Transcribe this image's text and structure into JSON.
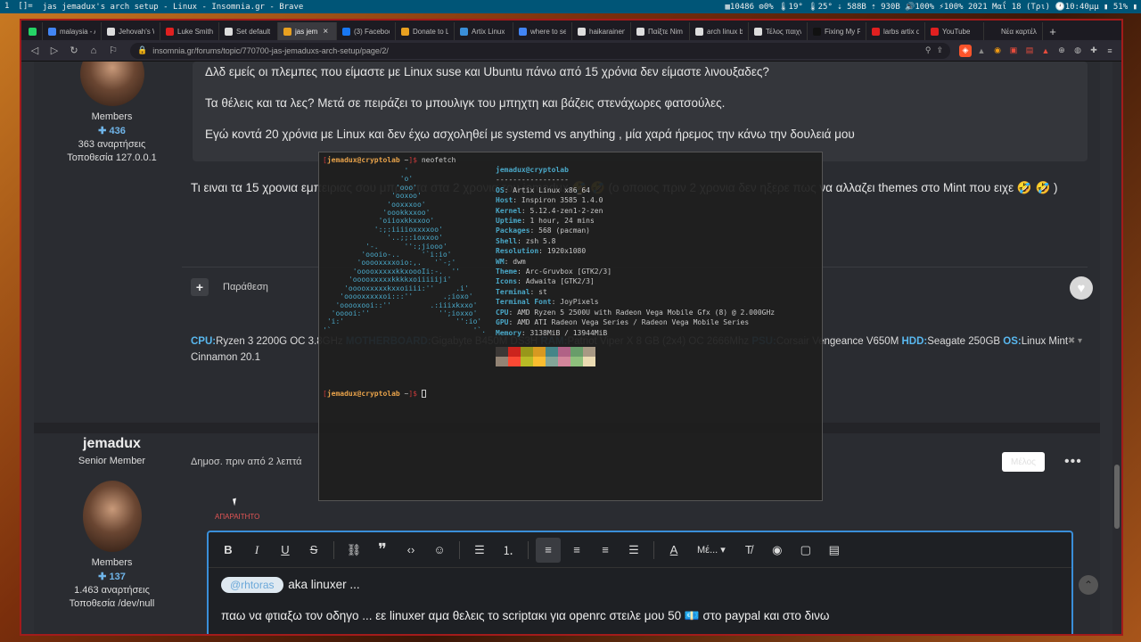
{
  "statusbar": {
    "tags": "1",
    "layout": "[]=",
    "title": "jas jemadux's arch setup - Linux - Insomnia.gr - Brave",
    "right": "▦10486 ⚙0% 🌡19° 🌡25° ⇣ 588B ⇡ 930B 🔊100% ⚡100% 2021 Μαΐ 18 (Τρι) 🕐10:40μμ ▮ 51% ▮"
  },
  "tabs": [
    {
      "label": "",
      "pinned": true,
      "color": "#25d366"
    },
    {
      "label": "malaysia - A",
      "color": "#4285f4"
    },
    {
      "label": "Jehovah's W",
      "color": "#dddddd"
    },
    {
      "label": "Luke Smith",
      "color": "#e02020"
    },
    {
      "label": "Set default",
      "color": "#dddddd"
    },
    {
      "label": "jas jem",
      "active": true,
      "color": "#e8a020"
    },
    {
      "label": "(3) Faceboo",
      "color": "#1877f2"
    },
    {
      "label": "Donate to L",
      "color": "#e8a020"
    },
    {
      "label": "Artix Linux",
      "color": "#3a8fd9"
    },
    {
      "label": "where to se",
      "color": "#4285f4"
    },
    {
      "label": "haikarainen",
      "color": "#dddddd"
    },
    {
      "label": "Παίξτε Nim",
      "color": "#dddddd"
    },
    {
      "label": "arch linux b",
      "color": "#dddddd"
    },
    {
      "label": "Τέλος παιχν",
      "color": "#dddddd"
    },
    {
      "label": "Fixing My F",
      "color": "#111111"
    },
    {
      "label": "larbs artix d",
      "color": "#e02020"
    },
    {
      "label": "YouTube",
      "color": "#e02020"
    },
    {
      "label": "Νέα καρτέλα",
      "color": "#1c1b22"
    }
  ],
  "toolbar": {
    "url": "insomnia.gr/forums/topic/770700-jas-jemaduxs-arch-setup/page/2/"
  },
  "post1": {
    "role": "Members",
    "reputation": "436",
    "posts": "363 αναρτήσεις",
    "location": "Τοποθεσία 127.0.0.1",
    "quote_lines": [
      "Δλδ εμείς οι πλεμπες που είμαστε με Linux suse και Ubuntu πάνω από 15 χρόνια δεν είμαστε λινουξαδες?",
      "Τα θέλεις και τα λες? Μετά σε πειράζει το μπουλιγκ του μπηχτη και βάζεις στενάχωρες φατσούλες.",
      "Εγώ κοντά 20 χρόνια με Linux και δεν έχω ασχοληθεί με systemd vs anything , μία χαρά ήρεμος την κάνω την δουλειά μου"
    ],
    "body": "Τι ειναι τα 15 χρονια εμπειριας σου μπροστα στα 2 χρονια του jemadux 🤣 🤣 (ο οποιος πριν 2 χρονια δεν ηξερε πως να αλλαζει themes στο Mint  που ειχε 🤣 🤣 )",
    "quote_action": "Παράθεση",
    "signature": [
      {
        "k": "CPU:",
        "v": "Ryzen 3 2200G OC 3.8GHz "
      },
      {
        "k": "MOTHERBOARD:",
        "v": "Gigabyte B450M DS3H "
      },
      {
        "k": "RAM:",
        "v": "Patriot Viper X 8 GB (2x4) OC 2666Mhz "
      },
      {
        "k": "PSU:",
        "v": "Corsair Vengeance V650M "
      },
      {
        "k": "HDD:",
        "v": "Seagate 250GB "
      },
      {
        "k": "OS:",
        "v": "Linux Mint Cinnamon 20.1"
      }
    ]
  },
  "post2": {
    "author": "jemadux",
    "rank": "Senior Member",
    "role": "Members",
    "reputation": "137",
    "posts": "1.463 αναρτήσεις",
    "location": "Τοποθεσία /dev/null",
    "meta": "Δημοσ. πριν από 2 λεπτά",
    "more_label": "Μέλος",
    "dots": "•••"
  },
  "editor": {
    "required_label": "ΑΠΑΡΑΙΤΗΤΟ",
    "format_label": "Μέ... ▾",
    "mention": "@rhtoras",
    "line1_rest": " aka linuxer ...",
    "line2": "παω να φτιαξω τον οδηγο ... εε linuxer αμα θελεις το scriptακι για openrc στειλε μου 50 💶 στο paypal και στο δινω"
  },
  "terminal": {
    "prompt_user": "jemadux@cryptolab",
    "prompt_dir": " ~",
    "command": "neofetch",
    "header": "jemadux@cryptolab",
    "underline": "-----------------",
    "info": [
      {
        "k": "OS",
        "v": "Artix Linux x86_64"
      },
      {
        "k": "Host",
        "v": "Inspiron 3585 1.4.0"
      },
      {
        "k": "Kernel",
        "v": "5.12.4-zen1-2-zen"
      },
      {
        "k": "Uptime",
        "v": "1 hour, 24 mins"
      },
      {
        "k": "Packages",
        "v": "568 (pacman)"
      },
      {
        "k": "Shell",
        "v": "zsh 5.8"
      },
      {
        "k": "Resolution",
        "v": "1920x1080"
      },
      {
        "k": "WM",
        "v": "dwm"
      },
      {
        "k": "Theme",
        "v": "Arc-Gruvbox [GTK2/3]"
      },
      {
        "k": "Icons",
        "v": "Adwaita [GTK2/3]"
      },
      {
        "k": "Terminal",
        "v": "st"
      },
      {
        "k": "Terminal Font",
        "v": "JoyPixels"
      },
      {
        "k": "CPU",
        "v": "AMD Ryzen 5 2500U with Radeon Vega Mobile Gfx (8) @ 2.000GHz"
      },
      {
        "k": "GPU",
        "v": "AMD ATI Radeon Vega Series / Radeon Vega Mobile Series"
      },
      {
        "k": "Memory",
        "v": "3138MiB / 13944MiB"
      }
    ],
    "logo": "                   '\n                  'o'\n                 'ooo'\n                'ooxoo'\n               'ooxxxoo'\n              'oookkxxoo'\n             'oiioxkkxxoo'\n            ':;:iiiioxxxxoo'\n               '..;;:ioxxoo'\n          '-.      '':;jiooo'\n         'oooio-..     '`i:io'\n        'ooooxxxxoio:,.   '`-;'\n       'ooooxxxxxkkxoooIi:-.  ''\n      'ooooxxxxxkkkkxoiiiiiji'\n     'ooooxxxxxkxxoiiii:''     .i'\n    'ooooxxxxxoi:::''       .;ioxo'\n   'ooooxooi::''         .:iiixkxxo'\n  'ooooi:''                '';ioxxo'\n 'i:'                          '':io'\n'`                                 '`.",
    "palette_top": [
      "#3c3836",
      "#cc241d",
      "#98971a",
      "#d79921",
      "#458588",
      "#b16286",
      "#689d6a",
      "#a89984"
    ],
    "palette_bottom": [
      "#928374",
      "#fb4934",
      "#b8bb26",
      "#fabd2f",
      "#83a598",
      "#d3869b",
      "#8ec07c",
      "#ebdbb2"
    ]
  }
}
